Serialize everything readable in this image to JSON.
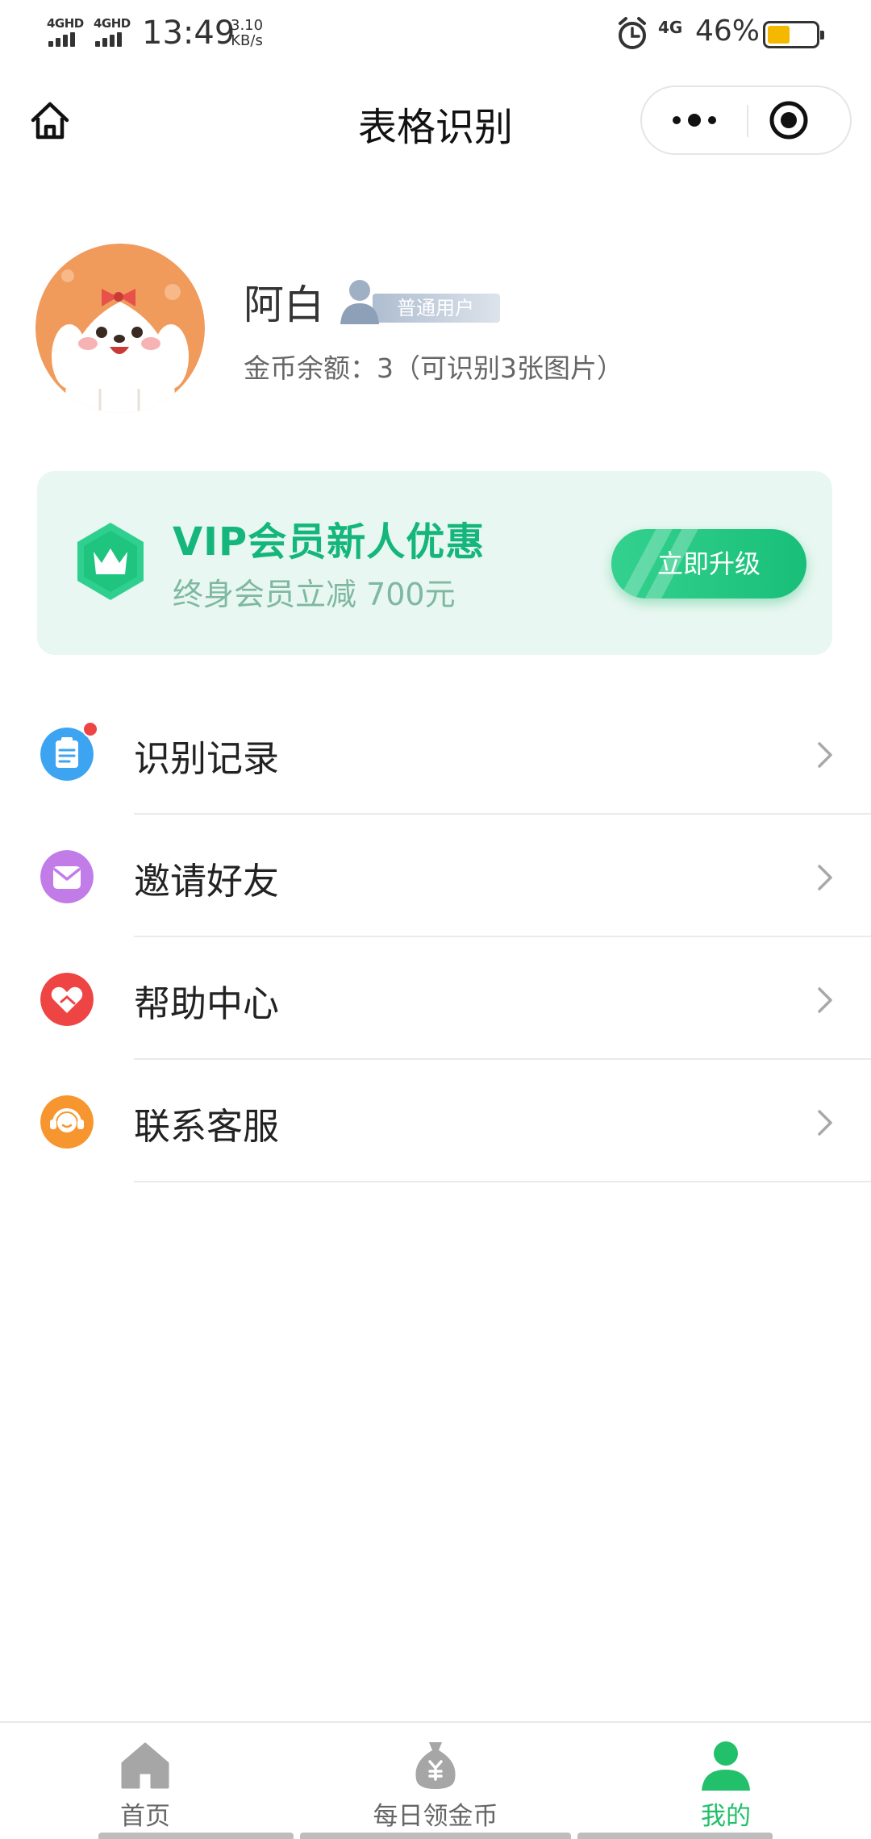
{
  "status_bar": {
    "net1": "4GHD",
    "net2": "4GHD",
    "time": "13:49",
    "speed_value": "3.10",
    "speed_unit": "KB/s",
    "net_type": "4G",
    "battery_percent": "46%",
    "battery_level": 0.46,
    "battery_color": "#f5b800"
  },
  "nav": {
    "title": "表格识别"
  },
  "profile": {
    "name": "阿白",
    "badge": "普通用户",
    "coins": "金币余额：3（可识别3张图片）"
  },
  "vip": {
    "title": "VIP会员新人优惠",
    "subtitle": "终身会员立减 700元",
    "button": "立即升级"
  },
  "menu": [
    {
      "label": "识别记录",
      "icon": "clipboard-icon",
      "color": "#3da4f2",
      "has_dot": true
    },
    {
      "label": "邀请好友",
      "icon": "envelope-icon",
      "color": "#c27ce8",
      "has_dot": false
    },
    {
      "label": "帮助中心",
      "icon": "handshake-icon",
      "color": "#ef4444",
      "has_dot": false
    },
    {
      "label": "联系客服",
      "icon": "headset-icon",
      "color": "#f7962e",
      "has_dot": false
    }
  ],
  "tabs": [
    {
      "label": "首页",
      "icon": "home-icon",
      "active": false
    },
    {
      "label": "每日领金币",
      "icon": "money-bag-icon",
      "active": false
    },
    {
      "label": "我的",
      "icon": "user-icon",
      "active": true
    }
  ],
  "colors": {
    "accent": "#22c06a",
    "vip_green": "#14b67b",
    "tab_inactive": "#9e9e9e"
  }
}
